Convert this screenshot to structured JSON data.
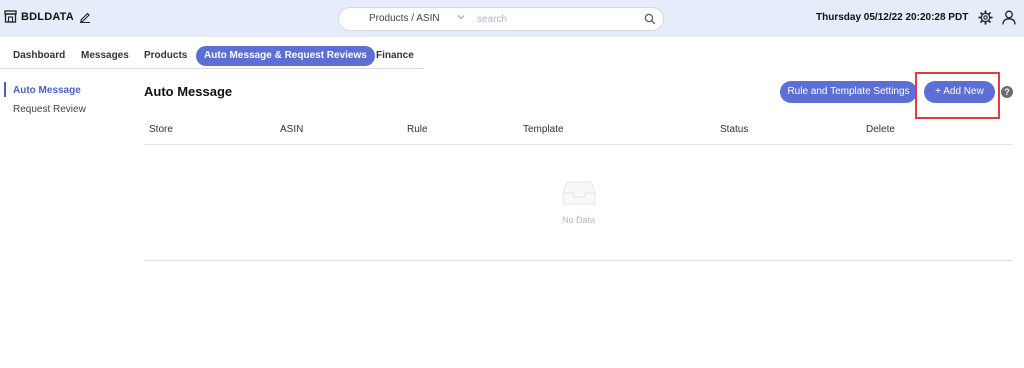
{
  "header": {
    "brand": "BDLDATA",
    "search_select": "Products / ASIN",
    "search_placeholder": "search",
    "datetime": "Thursday 05/12/22 20:20:28 PDT",
    "icons": [
      "store-icon",
      "edit-icon",
      "chevron-down-icon",
      "search-icon",
      "gear-icon",
      "user-icon"
    ]
  },
  "nav": {
    "tabs": [
      {
        "label": "Dashboard",
        "active": false
      },
      {
        "label": "Messages",
        "active": false
      },
      {
        "label": "Products",
        "active": false
      },
      {
        "label": "Auto Message & Request Reviews",
        "active": true
      },
      {
        "label": "Finance",
        "active": false
      }
    ]
  },
  "sidebar": {
    "items": [
      {
        "label": "Auto Message",
        "active": true
      },
      {
        "label": "Request Review",
        "active": false
      }
    ]
  },
  "main": {
    "title": "Auto Message",
    "settings_button": "Rule and Template Settings",
    "add_button": "+ Add New",
    "help": "?",
    "columns": [
      "Store",
      "ASIN",
      "Rule",
      "Template",
      "Status",
      "Delete"
    ],
    "empty_text": "No Data"
  },
  "colors": {
    "header_bg": "#e6ecfa",
    "accent": "#5b6fd6",
    "highlight": "#e8383c"
  }
}
